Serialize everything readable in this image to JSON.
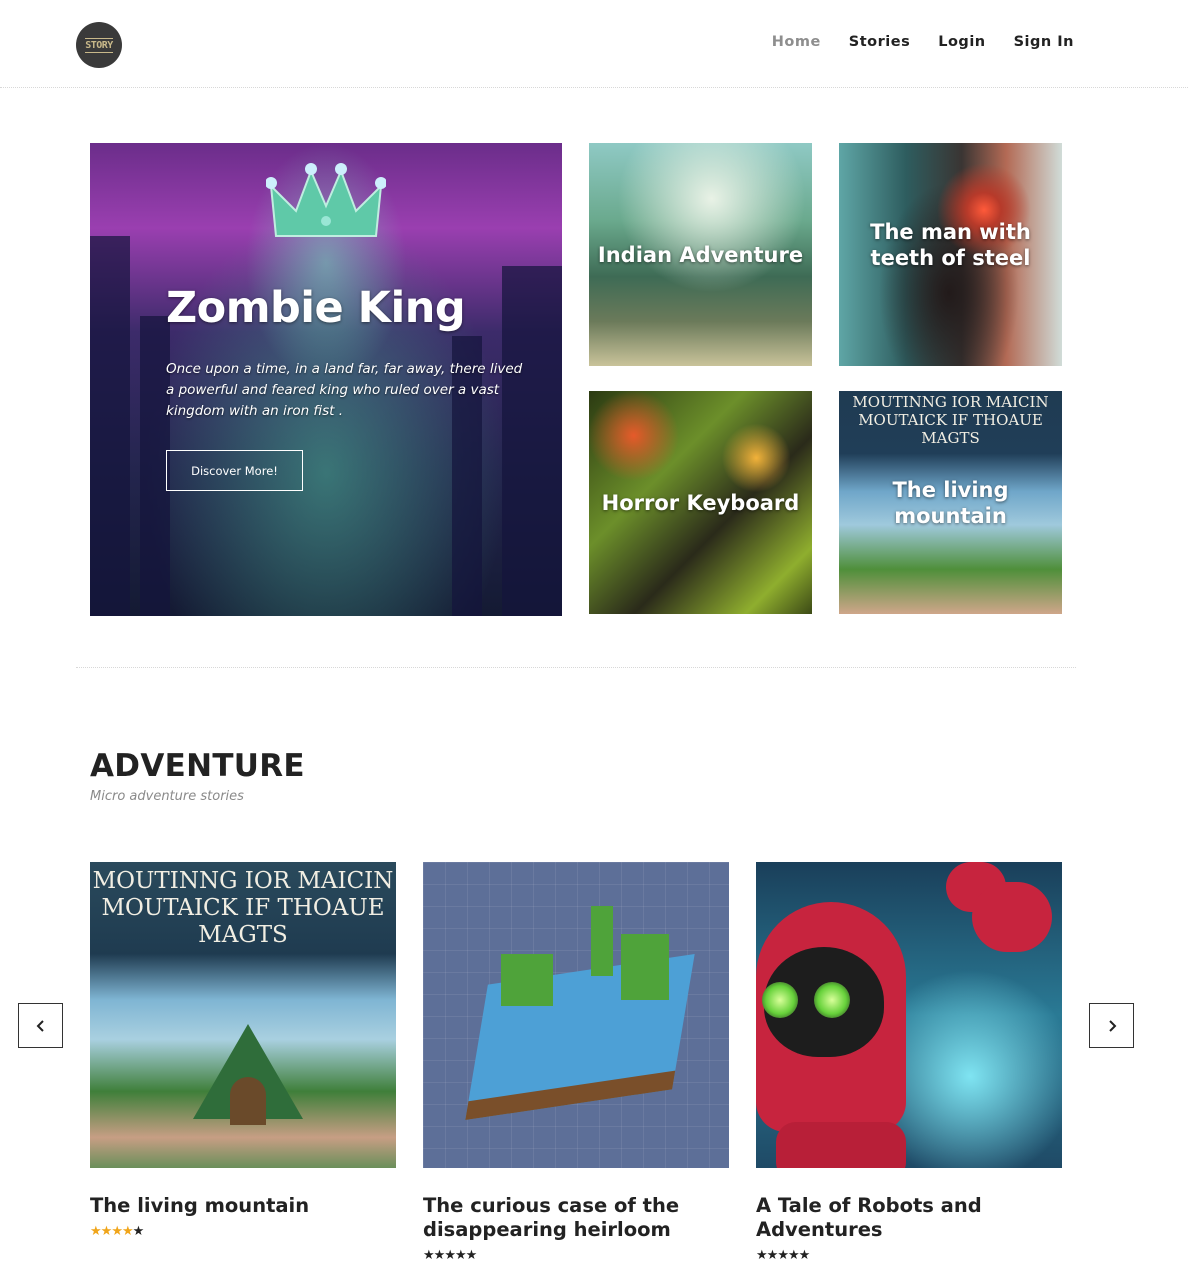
{
  "header": {
    "logo_text": "STORY",
    "nav": [
      {
        "label": "Home",
        "active": true
      },
      {
        "label": "Stories",
        "active": false
      },
      {
        "label": "Login",
        "active": false
      },
      {
        "label": "Sign In",
        "active": false
      }
    ]
  },
  "hero": {
    "featured": {
      "title": "Zombie King",
      "excerpt": "Once upon a time, in a land far, far away, there lived a powerful and feared king who ruled over a vast kingdom with an iron fist .",
      "button_label": "Discover More!"
    },
    "tiles": [
      {
        "title": "Indian Adventure"
      },
      {
        "title": "The man with teeth of steel"
      },
      {
        "title": "Horror Keyboard"
      },
      {
        "title": "The living mountain"
      }
    ],
    "tile_art_text": "MOUTINNG IOR MAICIN MOUTAICK IF THOAUE MAGTS"
  },
  "section": {
    "title": "ADVENTURE",
    "subtitle": "Micro adventure stories",
    "cards": [
      {
        "title": "The living mountain",
        "rating": 4,
        "max_rating": 5,
        "art_text": "MOUTINNG IOR MAICIN MOUTAICK IF THOAUE MAGTS"
      },
      {
        "title": "The curious case of the disappearing heirloom",
        "rating": 5,
        "max_rating": 5
      },
      {
        "title": "A Tale of Robots and Adventures",
        "rating": 5,
        "max_rating": 5
      }
    ],
    "prev_icon": "chevron-left-icon",
    "next_icon": "chevron-right-icon"
  },
  "colors": {
    "star_rated": "#f0a51a",
    "star_unrated": "#222222",
    "nav_active": "#8e8e8e"
  }
}
